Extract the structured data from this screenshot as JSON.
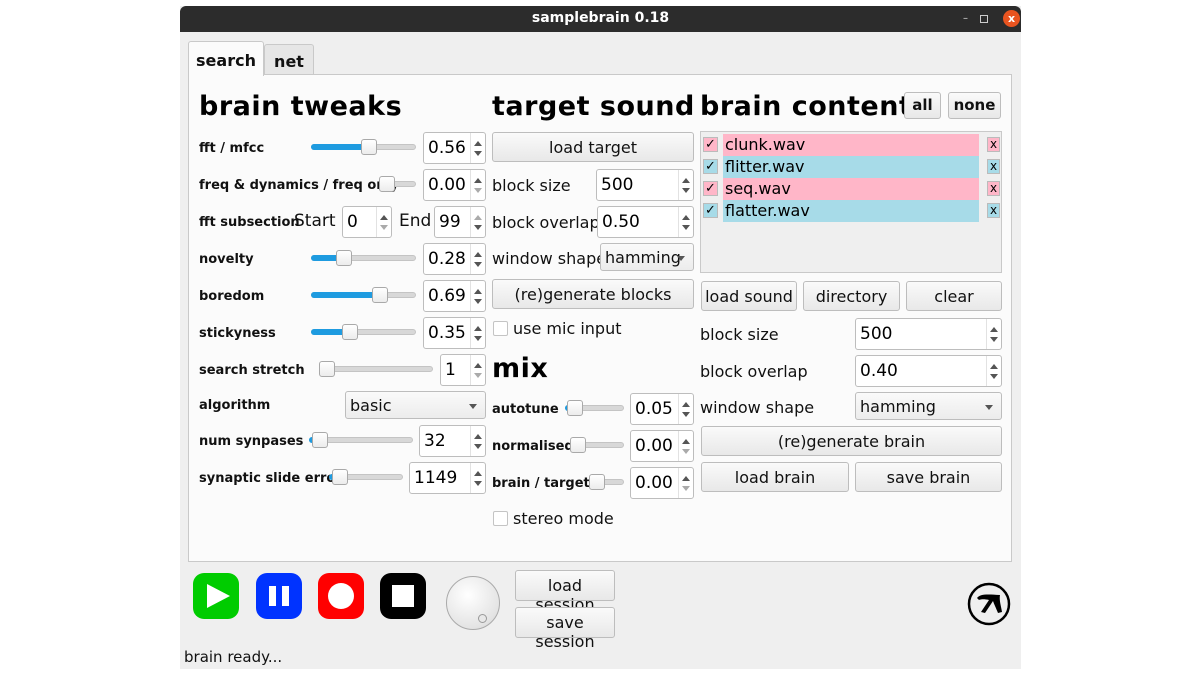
{
  "window": {
    "title": "samplebrain 0.18",
    "controls": {
      "minimize": "–",
      "maximize": "",
      "close": "x"
    }
  },
  "tabs": [
    {
      "label": "search",
      "active": true
    },
    {
      "label": "net",
      "active": false
    }
  ],
  "brain_tweaks": {
    "heading": "brain tweaks",
    "fft_mfcc": {
      "label": "fft / mfcc",
      "value": "0.56",
      "slider": 0.56
    },
    "freq_dynamics": {
      "label": "freq & dynamics / freq only",
      "value": "0.00",
      "slider": 0.0
    },
    "fft_subsection": {
      "label": "fft subsection",
      "start_label": "Start",
      "start_value": "0",
      "end_label": "End",
      "end_value": "99"
    },
    "novelty": {
      "label": "novelty",
      "value": "0.28",
      "slider": 0.28
    },
    "boredom": {
      "label": "boredom",
      "value": "0.69",
      "slider": 0.69
    },
    "stickyness": {
      "label": "stickyness",
      "value": "0.35",
      "slider": 0.35
    },
    "search_stretch": {
      "label": "search stretch",
      "value": "1",
      "slider": 0.0
    },
    "algorithm": {
      "label": "algorithm",
      "value": "basic"
    },
    "num_synapses": {
      "label": "num synpases",
      "value": "32",
      "slider": 0.03
    },
    "synaptic_slide_error": {
      "label": "synaptic slide error",
      "value": "1149",
      "slider": 0.05
    }
  },
  "target_sound": {
    "heading": "target sound",
    "load_target": "load target",
    "block_size": {
      "label": "block size",
      "value": "500"
    },
    "block_overlap": {
      "label": "block overlap",
      "value": "0.50"
    },
    "window_shape": {
      "label": "window shape",
      "value": "hamming"
    },
    "regenerate_blocks": "(re)generate blocks",
    "use_mic_input": {
      "label": "use mic input",
      "checked": false
    }
  },
  "mix": {
    "heading": "mix",
    "autotune": {
      "label": "autotune",
      "value": "0.05",
      "slider": 0.05
    },
    "normalised": {
      "label": "normalised",
      "value": "0.00",
      "slider": 0.0
    },
    "brain_target": {
      "label": "brain / target",
      "value": "0.00",
      "slider": 0.0
    },
    "stereo_mode": {
      "label": "stereo mode",
      "checked": false
    }
  },
  "brain_contents": {
    "heading": "brain contents",
    "all_label": "all",
    "none_label": "none",
    "items": [
      {
        "name": "clunk.wav",
        "checked": true,
        "color": "#ffb6c8",
        "check_mark": "✓",
        "delete_label": "x"
      },
      {
        "name": "flitter.wav",
        "checked": true,
        "color": "#a7dbe8",
        "check_mark": "✓",
        "delete_label": "x"
      },
      {
        "name": "seq.wav",
        "checked": true,
        "color": "#ffb6c8",
        "check_mark": "✓",
        "delete_label": "x"
      },
      {
        "name": "flatter.wav",
        "checked": true,
        "color": "#a7dbe8",
        "check_mark": "✓",
        "delete_label": "x"
      }
    ],
    "load_sound": "load sound",
    "directory": "directory",
    "clear": "clear",
    "block_size": {
      "label": "block size",
      "value": "500"
    },
    "block_overlap": {
      "label": "block overlap",
      "value": "0.40"
    },
    "window_shape": {
      "label": "window shape",
      "value": "hamming"
    },
    "regenerate_brain": "(re)generate brain",
    "load_brain": "load brain",
    "save_brain": "save brain"
  },
  "transport": {
    "play_color": "#00cc00",
    "pause_color": "#0033ff",
    "record_color": "#ff0000",
    "stop_color": "#000000",
    "load_session": "load session",
    "save_session": "save session"
  },
  "status": "brain ready..."
}
